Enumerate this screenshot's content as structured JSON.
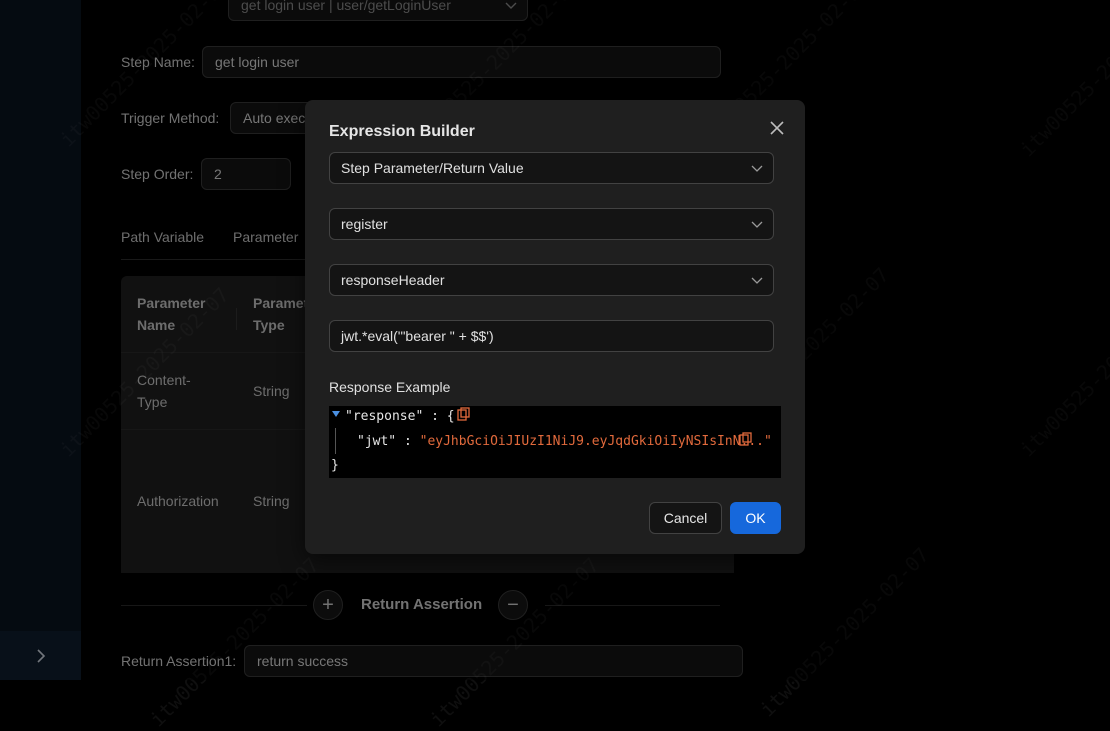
{
  "form": {
    "top_select_value": "get login user | user/getLoginUser",
    "step_name_label": "Step Name:",
    "step_name_value": "get login user",
    "trigger_method_label": "Trigger Method:",
    "trigger_method_value": "Auto exec",
    "step_order_label": "Step Order:",
    "step_order_value": "2"
  },
  "tabs": [
    "Path Variable",
    "Parameter"
  ],
  "table": {
    "headers": [
      "Parameter Name",
      "Paramet Type"
    ],
    "rows": [
      {
        "name": "Content-Type",
        "type": "String"
      },
      {
        "name": "Authorization",
        "type": "String"
      }
    ]
  },
  "return_assertion": {
    "title": "Return Assertion",
    "label": "Return Assertion1:",
    "value": "return success"
  },
  "modal": {
    "title": "Expression Builder",
    "select_1": "Step Parameter/Return Value",
    "select_2": "register",
    "select_3": "responseHeader",
    "expression": "jwt.*eval('\"bearer \" + $$')",
    "response_label": "Response Example",
    "json": {
      "root_key": "\"response\"",
      "child_key": "\"jwt\"",
      "child_value": "\"eyJhbGciOiJIUzI1NiJ9.eyJqdGkiOiIyNSIsInN...\"",
      "close_brace": "}"
    },
    "cancel_label": "Cancel",
    "ok_label": "OK"
  },
  "watermark_text": "itw00525-2025-02-07",
  "colors": {
    "primary": "#1668dc",
    "json_string": "#e26a3c",
    "json_icon": "#e26a3c",
    "modal_bg": "#1f1f1f"
  }
}
